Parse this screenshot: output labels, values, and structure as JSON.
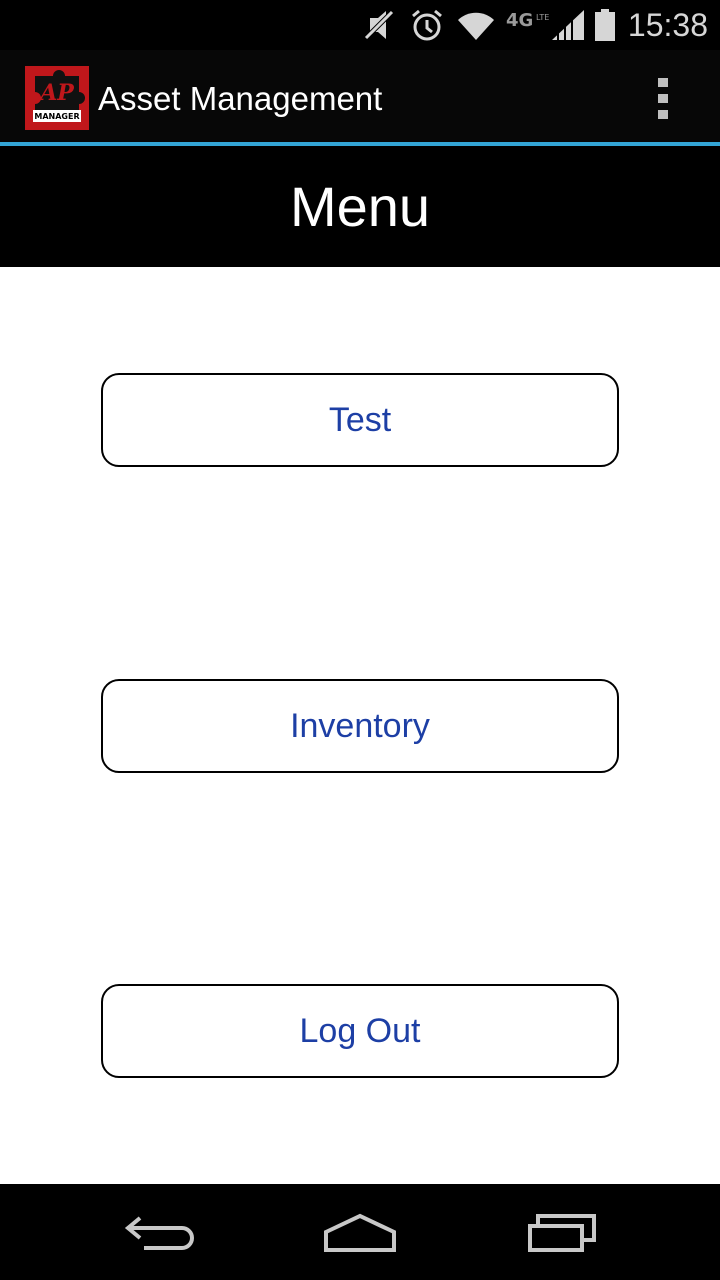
{
  "status_bar": {
    "time": "15:38",
    "icons": [
      "mute-icon",
      "alarm-icon",
      "wifi-icon",
      "4g-lte-icon",
      "signal-icon",
      "battery-icon"
    ]
  },
  "action_bar": {
    "logo_text_top": "AP",
    "logo_text_bottom": "MANAGER",
    "title": "Asset Management"
  },
  "header": {
    "title": "Menu"
  },
  "buttons": {
    "test": "Test",
    "inventory": "Inventory",
    "logout": "Log Out"
  },
  "nav_bar": {
    "icons": [
      "back-icon",
      "home-icon",
      "recent-apps-icon"
    ]
  },
  "colors": {
    "accent_line": "#33a5d6",
    "button_text": "#1d3fa5",
    "logo_red": "#c0171b"
  }
}
